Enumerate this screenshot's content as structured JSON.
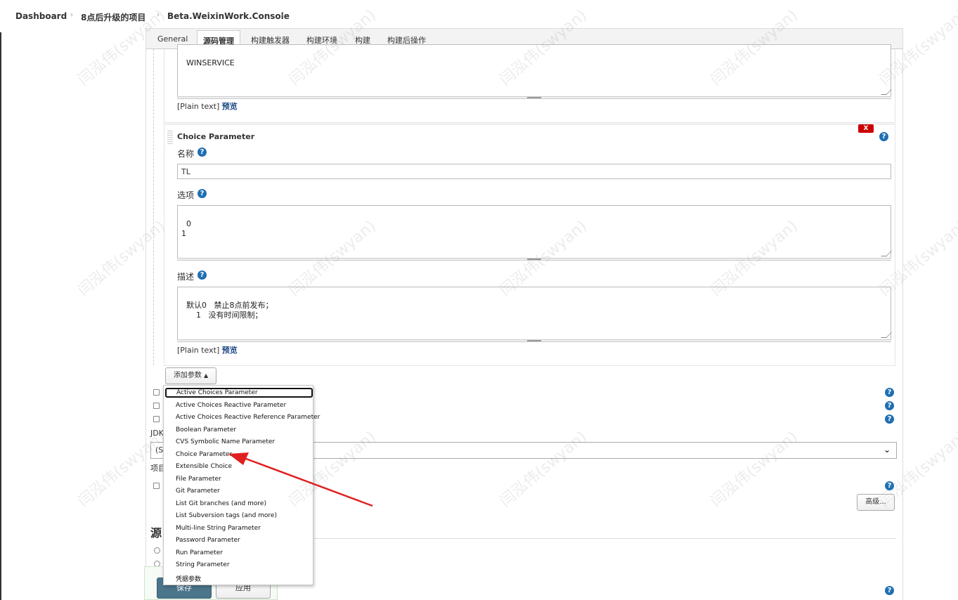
{
  "breadcrumb": {
    "items": [
      "Dashboard",
      "8点后升级的项目",
      "Beta.WeixinWork.Console"
    ],
    "separator": "›"
  },
  "tabs": [
    "General",
    "源码管理",
    "构建触发器",
    "构建环境",
    "构建",
    "构建后操作"
  ],
  "active_tab": "源码管理",
  "top_textarea": {
    "value": "WINSERVICE"
  },
  "plain_text_label": "[Plain text]",
  "preview_label": "预览",
  "choice_parameter": {
    "title": "Choice Parameter",
    "delete_label": "X",
    "name_label": "名称",
    "name_value": "TL",
    "choices_label": "选项",
    "choices_value": "0\n1",
    "description_label": "描述",
    "description_value": "默认0   禁止8点前发布；\n      1   没有时间限制；"
  },
  "add_param_button": "添加参数",
  "dropdown": {
    "items": [
      "Active Choices Parameter",
      "Active Choices Reactive Parameter",
      "Active Choices Reactive Reference Parameter",
      "Boolean Parameter",
      "CVS Symbolic Name Parameter",
      "Choice Parameter",
      "Extensible Choice",
      "File Parameter",
      "Git Parameter",
      "List Git branches (and more)",
      "List Subversion tags (and more)",
      "Multi-line String Parameter",
      "Password Parameter",
      "Run Parameter",
      "String Parameter",
      "凭据参数"
    ],
    "focused": "Active Choices Parameter"
  },
  "jdk_label": "JDK",
  "jdk_select_value": "(S",
  "project_label": "项目",
  "advanced_button": "高级...",
  "section_heading": "源",
  "save_button": "保存",
  "apply_button": "应用",
  "help_glyph": "?",
  "watermark": "闫泓伟(swyan)",
  "colors": {
    "accent": "#1f6fb2",
    "delete": "#cc0000",
    "save": "#4b758b",
    "arrow": "#e02020"
  }
}
